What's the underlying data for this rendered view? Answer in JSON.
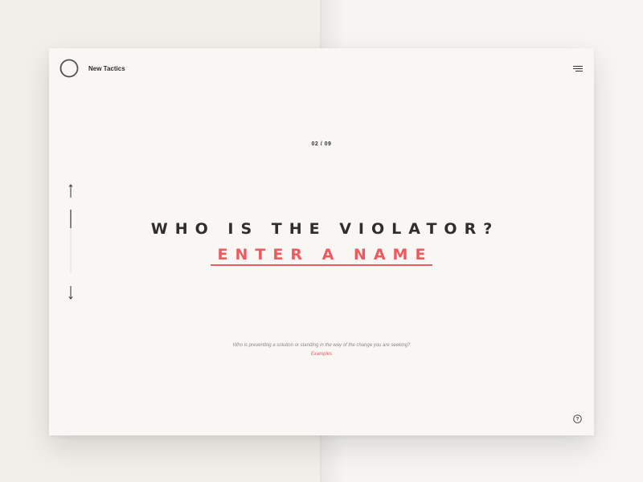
{
  "app": {
    "brand_name": "New Tactics"
  },
  "header": {
    "logo_icon": "circle-logo-icon",
    "menu_icon": "hamburger-menu-icon"
  },
  "progress": {
    "counter": "02 / 09",
    "current_step": 2,
    "total_steps": 9
  },
  "navigation": {
    "up_icon": "arrow-up-icon",
    "down_icon": "arrow-down-icon"
  },
  "main": {
    "question": "WHO IS THE VIOLATOR?",
    "answer_placeholder": "ENTER A NAME",
    "hint": "Who is preventing a solution or standing in the way of the change you are seeking?",
    "examples_link": "Examples"
  },
  "footer": {
    "help_icon": "question-mark-icon"
  },
  "colors": {
    "accent": "#ef5a61",
    "text": "#2f2d2d",
    "card_background": "#f8f7f4",
    "page_background": "#f1efea"
  }
}
